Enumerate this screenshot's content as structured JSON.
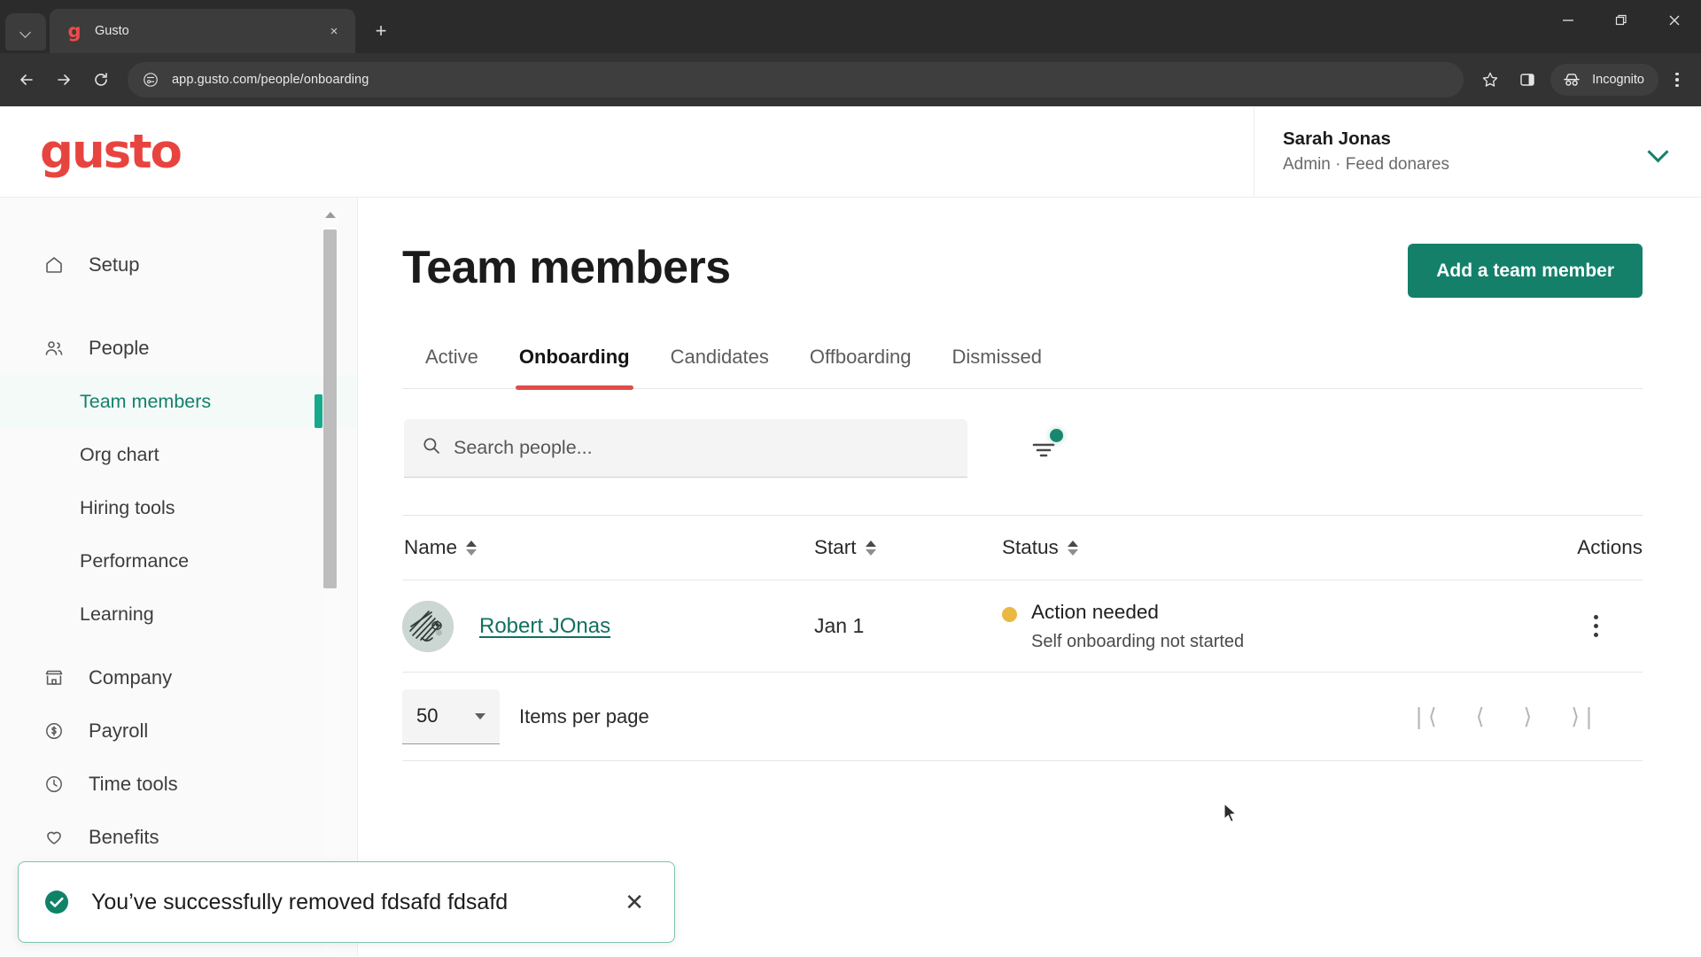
{
  "browser": {
    "tab": {
      "title": "Gusto",
      "favicon": "gusto-g-icon",
      "close_label": "×"
    },
    "new_tab_label": "+",
    "url": "app.gusto.com/people/onboarding",
    "incognito_label": "Incognito",
    "window": {
      "minimize": "minimize-icon",
      "maximize": "restore-icon",
      "close": "close-icon"
    },
    "nav": {
      "back": "back-icon",
      "forward": "forward-icon",
      "reload": "reload-icon"
    },
    "bookmark": "star-icon",
    "side_panel": "side-panel-icon",
    "menu": "kebab-menu-icon"
  },
  "header": {
    "logo_text": "gusto",
    "user": {
      "name": "Sarah Jonas",
      "role": "Admin · Feed donares"
    }
  },
  "sidebar": {
    "items": [
      {
        "label": "Setup",
        "icon": "home-icon"
      },
      {
        "label": "People",
        "icon": "people-icon"
      }
    ],
    "people_subitems": [
      {
        "label": "Team members",
        "active": true
      },
      {
        "label": "Org chart",
        "active": false
      },
      {
        "label": "Hiring tools",
        "active": false
      },
      {
        "label": "Performance",
        "active": false
      },
      {
        "label": "Learning",
        "active": false
      }
    ],
    "lower_items": [
      {
        "label": "Company",
        "icon": "store-icon"
      },
      {
        "label": "Payroll",
        "icon": "dollar-circle-icon"
      },
      {
        "label": "Time tools",
        "icon": "clock-icon"
      },
      {
        "label": "Benefits",
        "icon": "heart-icon"
      }
    ]
  },
  "main": {
    "title": "Team members",
    "add_button": "Add a team member",
    "tabs": [
      {
        "label": "Active",
        "active": false
      },
      {
        "label": "Onboarding",
        "active": true
      },
      {
        "label": "Candidates",
        "active": false
      },
      {
        "label": "Offboarding",
        "active": false
      },
      {
        "label": "Dismissed",
        "active": false
      }
    ],
    "search": {
      "placeholder": "Search people...",
      "value": ""
    },
    "filter": {
      "icon": "filter-icon",
      "has_notification": true
    },
    "table": {
      "columns": [
        {
          "label": "Name",
          "sortable": true
        },
        {
          "label": "Start",
          "sortable": true
        },
        {
          "label": "Status",
          "sortable": true
        },
        {
          "label": "Actions",
          "sortable": false
        }
      ],
      "rows": [
        {
          "name": "Robert JOnas",
          "start": "Jan 1",
          "status": "Action needed",
          "status_sub": "Self onboarding not started",
          "status_color": "#eab941"
        }
      ]
    },
    "pagination": {
      "per_page": "50",
      "per_page_label": "Items per page",
      "first": "❘⟨",
      "prev": "⟨",
      "next": "⟩",
      "last": "⟩❘"
    }
  },
  "toast": {
    "message": "You’ve successfully removed fdsafd fdsafd",
    "close_label": "✕",
    "icon": "check-circle-icon"
  },
  "colors": {
    "brand_red": "#e8443f",
    "teal": "#14806a",
    "tab_underline": "#e14b4b",
    "status_yellow": "#eab941"
  }
}
